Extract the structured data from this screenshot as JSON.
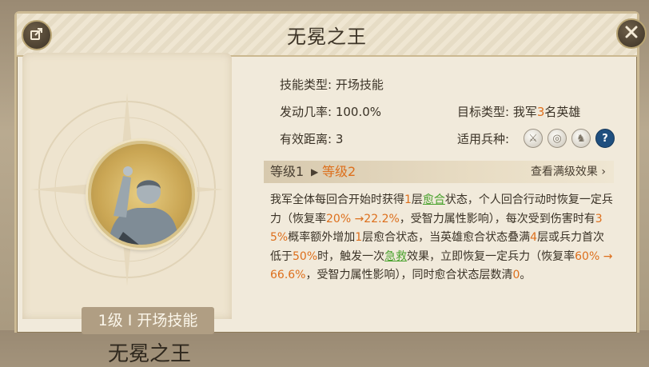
{
  "title": "无冕之王",
  "skill": {
    "tag": "1级 I 开场技能",
    "name": "无冕之王"
  },
  "info": {
    "type_label": "技能类型:",
    "type_value": "开场技能",
    "rate_label": "发动几率:",
    "rate_value": "100.0%",
    "target_label": "目标类型:",
    "target_pre": "我军",
    "target_num": "3",
    "target_post": "名英雄",
    "range_label": "有效距离:",
    "range_value": "3",
    "troops_label": "适用兵种:",
    "troop_icons": [
      "sword-icon",
      "shield-icon",
      "horse-icon",
      "help-icon"
    ]
  },
  "levels": {
    "current": "等级1",
    "next": "等级2",
    "view_full": "查看满级效果"
  },
  "description": {
    "p1": "我军全体每回合开始时获得",
    "n1": "1",
    "p2": "层",
    "k1": "愈合",
    "p3": "状态，个人回合行动时恢复一定兵力（恢复率",
    "n2": "20% →22.2%",
    "p4": "，受智力属性影响），每次受到伤害时有",
    "n3": "35%",
    "p5": "概率额外增加",
    "n4": "1",
    "p6": "层愈合状态，当英雄愈合状态叠满",
    "n5": "4",
    "p7": "层或兵力首次低于",
    "n6": "50%",
    "p8": "时，触发一次",
    "k2": "急救",
    "p9": "效果，立即恢复一定兵力（恢复率",
    "n7": "60% →66.6%",
    "p10": "，受智力属性影响），同时愈合状态层数清",
    "n8": "0",
    "p11": "。"
  }
}
